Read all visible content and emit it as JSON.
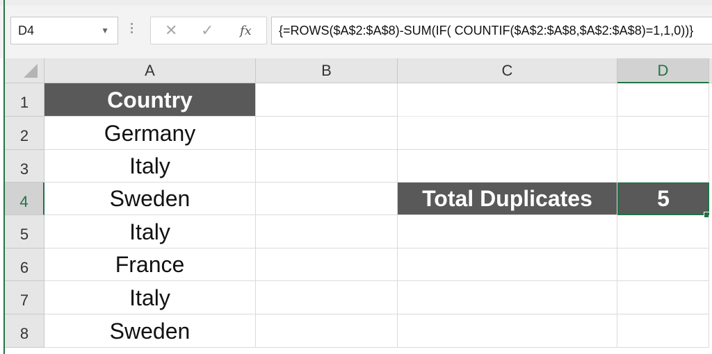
{
  "name_box": {
    "value": "D4"
  },
  "formula_bar": {
    "cancel_glyph": "✕",
    "enter_glyph": "✓",
    "fx_glyph": "fx",
    "formula": "{=ROWS($A$2:$A$8)-SUM(IF( COUNTIF($A$2:$A$8,$A$2:$A$8)=1,1,0))}"
  },
  "columns": [
    "A",
    "B",
    "C",
    "D"
  ],
  "rows": [
    "1",
    "2",
    "3",
    "4",
    "5",
    "6",
    "7",
    "8"
  ],
  "cells": {
    "A1": "Country",
    "A2": "Germany",
    "A3": "Italy",
    "A4": "Sweden",
    "A5": "Italy",
    "A6": "France",
    "A7": "Italy",
    "A8": "Sweden",
    "C4": "Total Duplicates",
    "D4": "5"
  },
  "colors": {
    "accent": "#217346",
    "header_fill": "#595959",
    "header_text": "#ffffff"
  },
  "icons": {
    "name_box_dropdown": "chevron-down-icon",
    "cancel": "close-icon",
    "enter": "check-icon",
    "insert_function": "fx-icon"
  }
}
